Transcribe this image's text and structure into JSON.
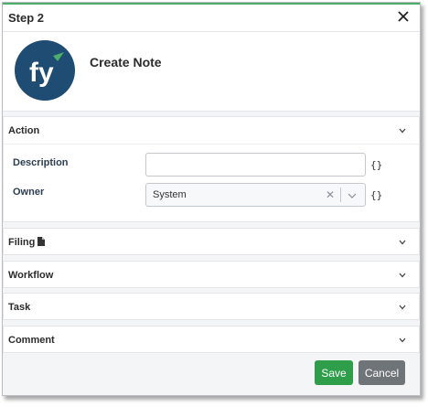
{
  "dialog": {
    "title": "Step 2"
  },
  "node": {
    "title": "Create Note",
    "logo_text": "fy"
  },
  "sections": {
    "action": "Action",
    "filing": "Filing",
    "workflow": "Workflow",
    "task": "Task",
    "comment": "Comment"
  },
  "fields": {
    "description": {
      "label": "Description",
      "value": "",
      "expression_toggle": "{}"
    },
    "owner": {
      "label": "Owner",
      "value": "System",
      "expression_toggle": "{}"
    }
  },
  "buttons": {
    "save": "Save",
    "cancel": "Cancel"
  },
  "colors": {
    "accent_green": "#2e9e4b",
    "header_top_border": "#4cae6a",
    "logo_background": "#1f4c72",
    "logo_accent": "#4cae6a",
    "cancel_gray": "#6f7479"
  },
  "icons": {
    "close": "close-icon",
    "filing": "document-icon",
    "collapse": "chevron-down-icon"
  }
}
